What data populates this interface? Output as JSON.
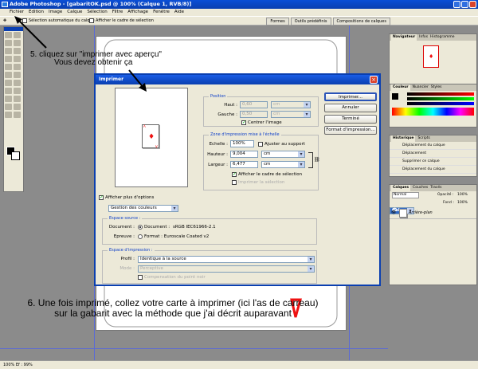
{
  "app": {
    "title": "Adobe Photoshop - [gabaritOK.psd @ 100% (Calque 1, RVB/8)]",
    "menu": [
      "Fichier",
      "Edition",
      "Image",
      "Calque",
      "Sélection",
      "Filtre",
      "Affichage",
      "Fenêtre",
      "Aide"
    ],
    "options": {
      "auto_select": "Sélection automatique du calque",
      "show_bounds": "Afficher le cadre de sélection",
      "tabs": [
        "Formes",
        "Outils prédéfinis",
        "Compositions de calques"
      ]
    },
    "status": "100%     Ef : 99%"
  },
  "instructions": {
    "step5_line1": "5. cliquez sur \"imprimer avec aperçu\"",
    "step5_line2": "Vous devez obtenir ça",
    "step6_line1": "6. Une fois imprimé, collez votre carte à imprimer (ici l'as de carreau)",
    "step6_line2": "sur la gabarit avec la méthode que j'ai décrit auparavant"
  },
  "panels": {
    "navigator_tabs": [
      "Navigateur",
      "Infos",
      "Histogramme"
    ],
    "color_tabs": [
      "Couleur",
      "Nuancier",
      "Styles"
    ],
    "history_tabs": [
      "Historique",
      "Scripts"
    ],
    "history_items": [
      "Déplacement du calque",
      "Déplacement",
      "Supprimer ce calque",
      "Déplacement du calque"
    ],
    "layers_tabs": [
      "Calques",
      "Couches",
      "Tracés"
    ],
    "layers_mode": "Normal",
    "opacity_label": "Opacité :",
    "opacity_value": "100%",
    "fill_label": "Fond :",
    "fill_value": "100%",
    "layers": [
      "Calque 1",
      "Arrière-plan"
    ]
  },
  "dialog": {
    "title": "Imprimer",
    "position": {
      "group": "Position",
      "top_label": "Haut :",
      "top_value": "0,60",
      "left_label": "Gauche :",
      "left_value": "0,50",
      "unit": "cm",
      "center_label": "Centrer l'image"
    },
    "scaled": {
      "group": "Zone d'impression mise à l'échelle",
      "scale_label": "Echelle :",
      "scale_value": "100%",
      "fit_label": "Ajuster au support",
      "height_label": "Hauteur :",
      "height_value": "9,004",
      "width_label": "Largeur :",
      "width_value": "6,477",
      "unit": "cm",
      "show_bounds_label": "Afficher le cadre de sélection",
      "print_selection_label": "Imprimer la sélection"
    },
    "buttons": [
      "Imprimer...",
      "Annuler",
      "Terminé",
      "Format d'impression..."
    ],
    "more_options": "Afficher plus d'options",
    "color_mgmt": "Gestion des couleurs",
    "source": {
      "group": "Espace source :",
      "document_label": "Document :",
      "document_radio": "Document :",
      "document_profile": "sRGB IEC61966-2.1",
      "proof_label": "Epreuve :",
      "proof_radio": "Format : Euroscale Coated v2"
    },
    "print_space": {
      "group": "Espace d'impression :",
      "profile_label": "Profil :",
      "profile_value": "Identique à la source",
      "mode_label": "Mode :",
      "mode_value": "Perceptive",
      "bpc_label": "Compensation du point noir"
    },
    "card": {
      "rank": "A",
      "suit": "♦"
    }
  }
}
